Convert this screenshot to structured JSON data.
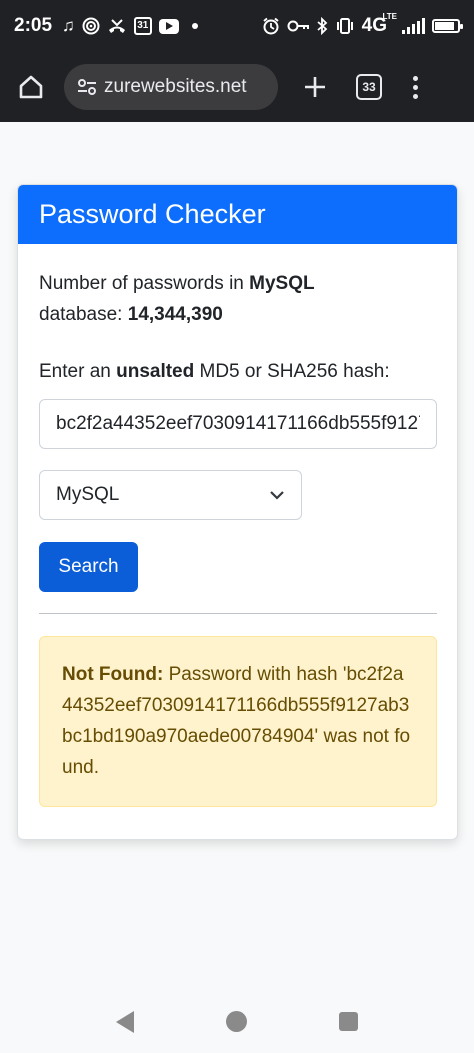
{
  "status_bar": {
    "time": "2:05",
    "calendar_day": "31",
    "network": "4G",
    "network_sub": "LTE",
    "battery_level": 0.85,
    "icons": [
      "music-note-icon",
      "podcast-icon",
      "missed-call-icon",
      "calendar-icon",
      "youtube-icon",
      "dot-icon",
      "alarm-icon",
      "key-icon",
      "bluetooth-icon",
      "vibrate-icon",
      "signal-icon",
      "battery-icon"
    ]
  },
  "browser": {
    "url": "zurewebsites.net",
    "tab_count": "33",
    "icons": [
      "home-icon",
      "tune-icon",
      "plus-icon",
      "tabs-icon",
      "more-vert-icon"
    ]
  },
  "card": {
    "title": "Password Checker",
    "count_prefix": "Number of passwords in ",
    "db_name": "MySQL",
    "count_mid": " database: ",
    "count_value": "14,344,390",
    "prompt_prefix": "Enter an ",
    "prompt_emphasis": "unsalted",
    "prompt_suffix": " MD5 or SHA256 hash:",
    "hash_value": "bc2f2a44352eef7030914171166db555f9127ab3bc1bd190a970aede00784904",
    "select_value": "MySQL",
    "search_label": "Search",
    "alert": {
      "label": "Not Found:",
      "message": " Password with hash 'bc2f2a44352eef7030914171166db555f9127ab3bc1bd190a970aede00784904' was not found."
    }
  },
  "colors": {
    "primary": "#0d6efd",
    "button": "#0b5ed7",
    "alert_bg": "#fff3cd",
    "alert_text": "#664d03",
    "chrome_dark": "#202124"
  }
}
